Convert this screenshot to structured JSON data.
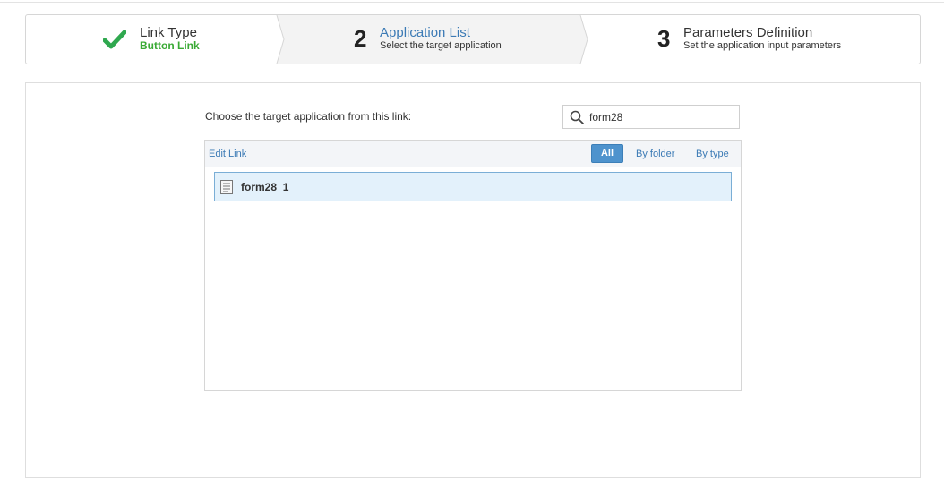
{
  "wizard": {
    "steps": [
      {
        "title": "Link Type",
        "subtitle": "Button Link",
        "state": "done",
        "icon": "check-icon"
      },
      {
        "number": "2",
        "title": "Application List",
        "subtitle": "Select the target application",
        "state": "active"
      },
      {
        "number": "3",
        "title": "Parameters Definition",
        "subtitle": "Set the application input parameters",
        "state": "pending"
      }
    ]
  },
  "main": {
    "prompt": "Choose the target application from this link:",
    "search": {
      "value": "form28",
      "icon": "search-icon"
    },
    "toolbar": {
      "edit_link": "Edit Link",
      "filters": [
        "All",
        "By folder",
        "By type"
      ],
      "active_filter": "All"
    },
    "applications": [
      {
        "name": "form28_1",
        "icon": "document-icon",
        "selected": true
      }
    ]
  },
  "colors": {
    "accent": "#3b7ab5",
    "success": "#3aaa35",
    "active_button": "#4e93cd",
    "selected_row": "#e3f1fb"
  }
}
